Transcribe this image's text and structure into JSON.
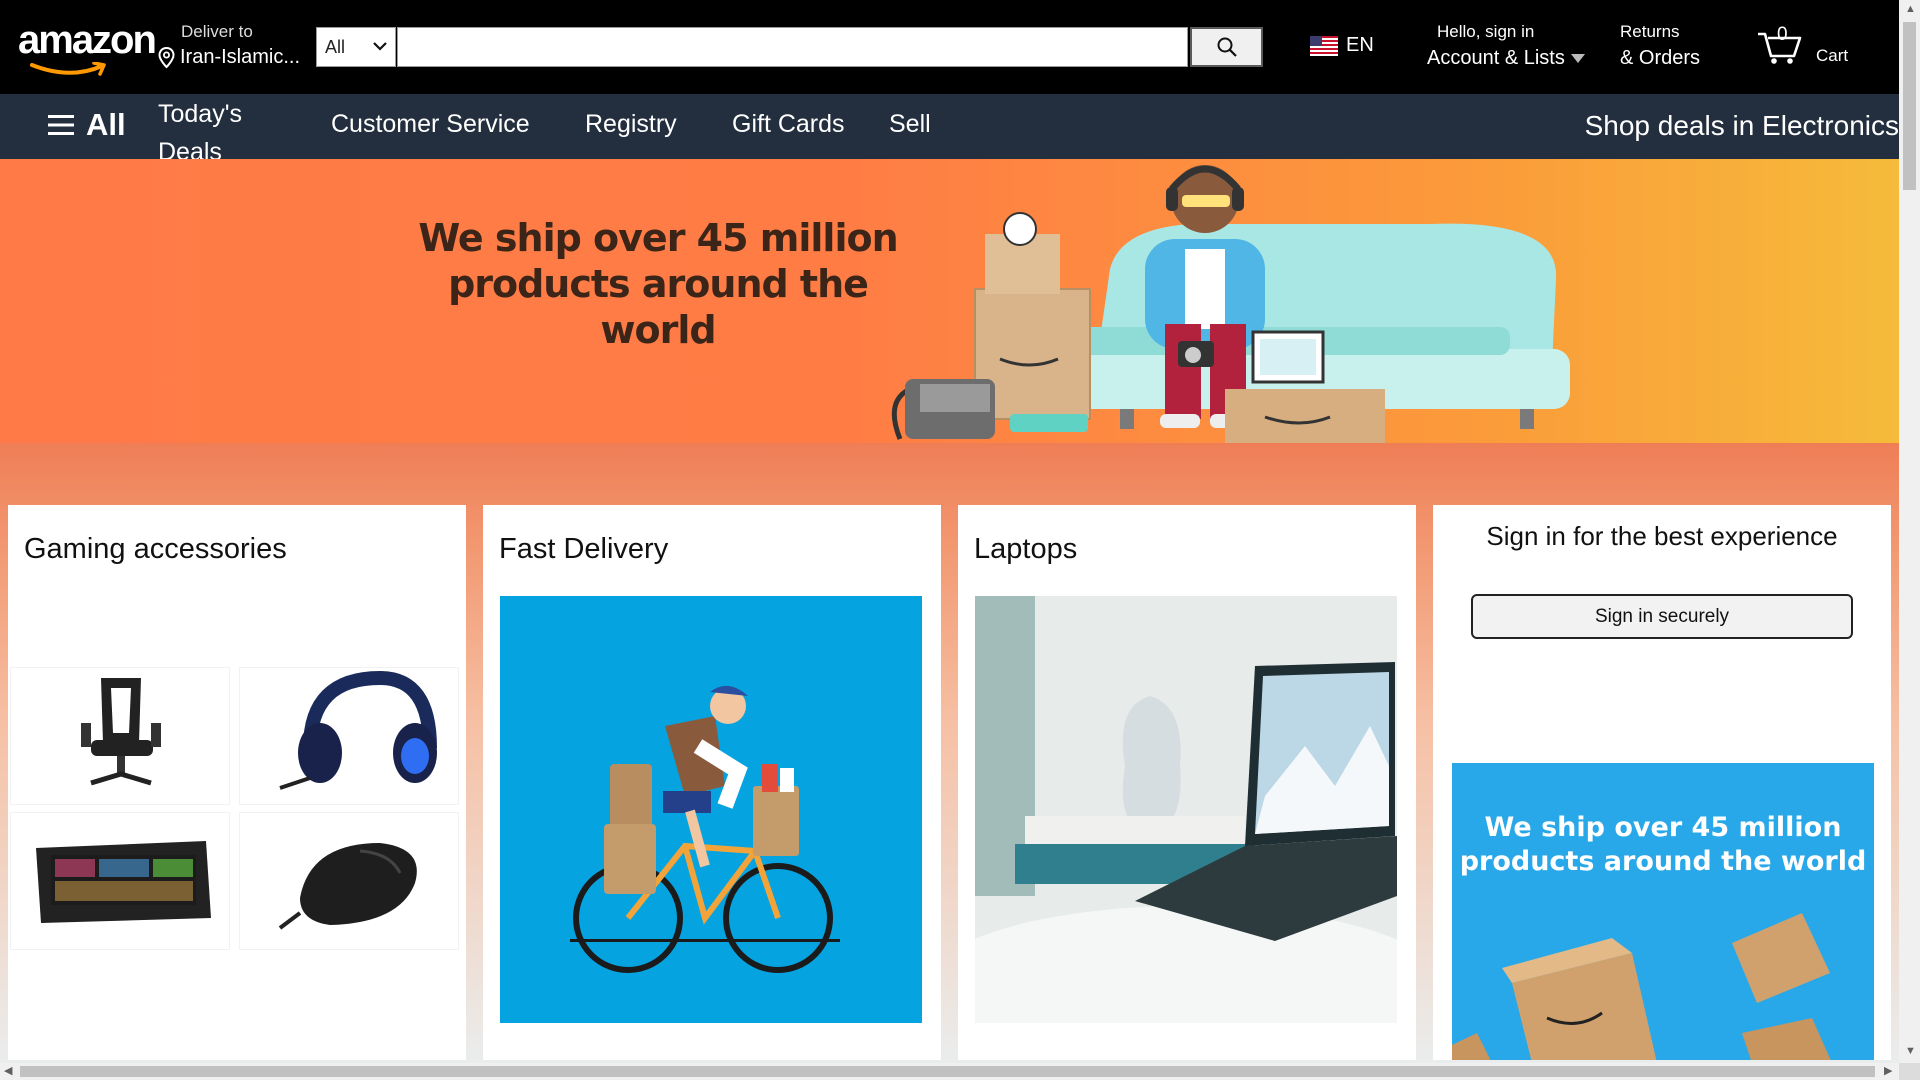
{
  "header": {
    "logo_text": "amazon",
    "deliver_label": "Deliver to",
    "deliver_location": "Iran-Islamic...",
    "search_category": "All",
    "search_value": "",
    "language": "EN",
    "account_greeting": "Hello, sign in",
    "account_label": "Account & Lists",
    "returns_label": "Returns",
    "orders_label": "& Orders",
    "cart_count": "0",
    "cart_label": "Cart"
  },
  "nav": {
    "all_label": "All",
    "items": [
      "Today's Deals",
      "Customer Service",
      "Registry",
      "Gift Cards",
      "Sell"
    ],
    "promo": "Shop deals in Electronics"
  },
  "hero": {
    "headline": "We ship over 45 million products around the world"
  },
  "cards": [
    {
      "title": "Gaming accessories"
    },
    {
      "title": "Fast Delivery"
    },
    {
      "title": "Laptops"
    },
    {
      "title": "Sign in for the best experience",
      "button": "Sign in securely",
      "promo_text": "We ship over 45 million products around the world"
    }
  ],
  "colors": {
    "header_bg": "#000000",
    "nav_bg": "#232f3e",
    "hero_orange": "#ff7a47",
    "hero_yellow": "#f6bb3a",
    "promo_blue": "#28a8e8",
    "delivery_blue": "#05a3e0"
  },
  "icons": [
    "location-pin-icon",
    "chevron-down-icon",
    "search-icon",
    "us-flag-icon",
    "caret-down-icon",
    "cart-icon",
    "hamburger-icon"
  ]
}
